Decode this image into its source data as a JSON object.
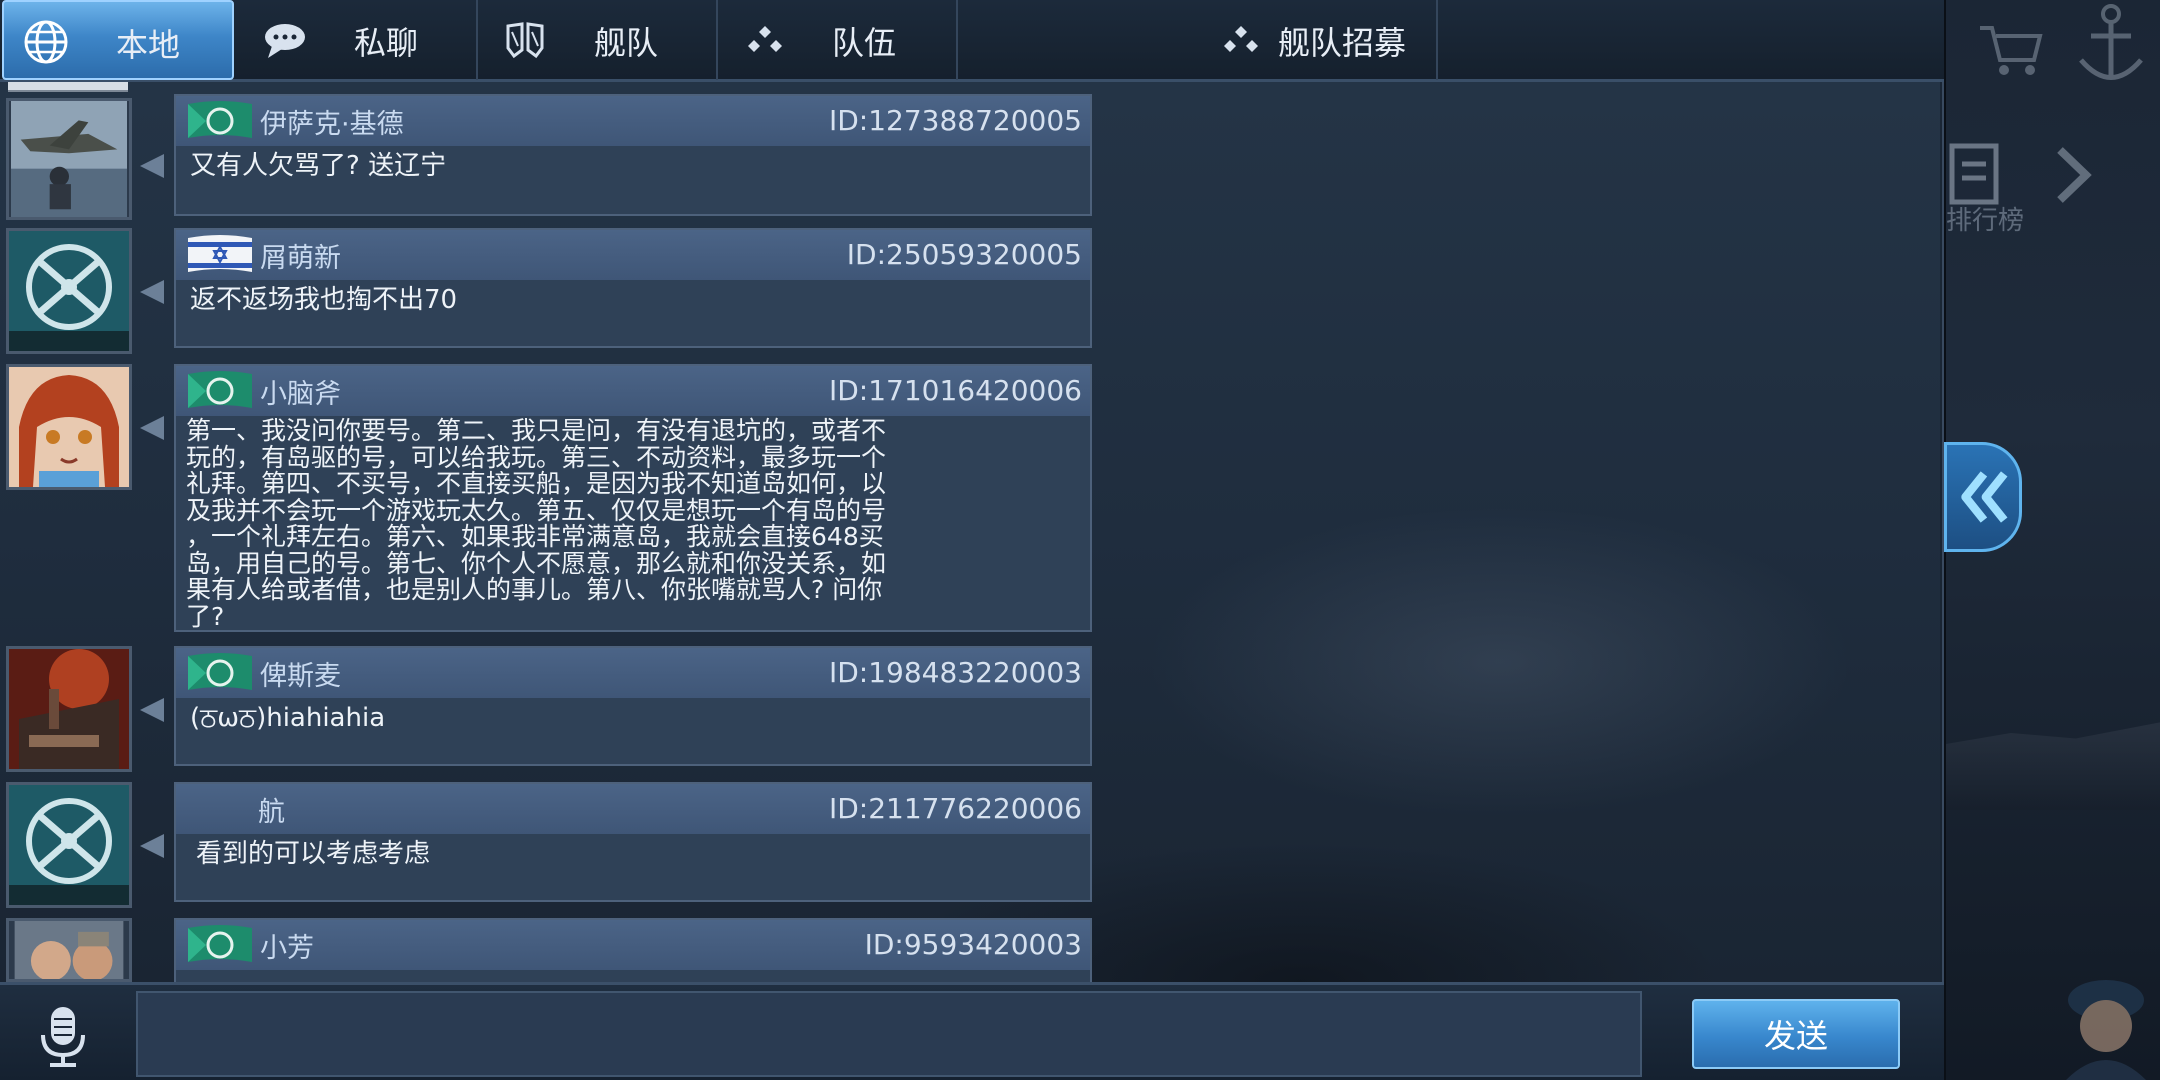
{
  "tabs": [
    {
      "label": "本地",
      "icon": "globe-icon",
      "active": true
    },
    {
      "label": "私聊",
      "icon": "chat-bubble-icon",
      "active": false
    },
    {
      "label": "舰队",
      "icon": "fleet-shield-icon",
      "active": false
    },
    {
      "label": "队伍",
      "icon": "team-dots-icon",
      "active": false
    },
    {
      "label": "舰队招募",
      "icon": "recruit-dots-icon",
      "active": false
    }
  ],
  "messages": [
    {
      "sender": "伊萨克·基德",
      "uid": "ID:127388720005",
      "text": "又有人欠骂了? 送辽宁",
      "flag": "green-flag"
    },
    {
      "sender": "屑萌新",
      "uid": "ID:25059320005",
      "text": "返不返场我也掏不出70",
      "flag": "israel-flag"
    },
    {
      "sender": "小脑斧",
      "uid": "ID:171016420006",
      "text": "第一、我没问你要号。第二、我只是问，有没有退坑的，或者不\n玩的，有岛驱的号，可以给我玩。第三、不动资料，最多玩一个\n礼拜。第四、不买号，不直接买船，是因为我不知道岛如何，以\n及我并不会玩一个游戏玩太久。第五、仅仅是想玩一个有岛的号\n，一个礼拜左右。第六、如果我非常满意岛，我就会直接648买\n岛，用自己的号。第七、你个人不愿意，那么就和你没关系，如\n果有人给或者借，也是别人的事儿。第八、你张嘴就骂人? 问你\n了?",
      "flag": "green-flag"
    },
    {
      "sender": "俾斯麦",
      "uid": "ID:198483220003",
      "text": "(ਠωਠ)hiahiahia",
      "flag": "green-flag"
    },
    {
      "sender": "航",
      "uid": "ID:211776220006",
      "text": "看到的可以考虑考虑",
      "flag": ""
    },
    {
      "sender": "小芳",
      "uid": "ID:9593420003",
      "text": "",
      "flag": "green-flag"
    }
  ],
  "side": {
    "rank_label": "排行榜"
  },
  "input": {
    "placeholder": ""
  },
  "send_label": "发送",
  "colors": {
    "accent": "#3e86c8",
    "bubble": "#2f4157",
    "header": "#4b6487"
  }
}
